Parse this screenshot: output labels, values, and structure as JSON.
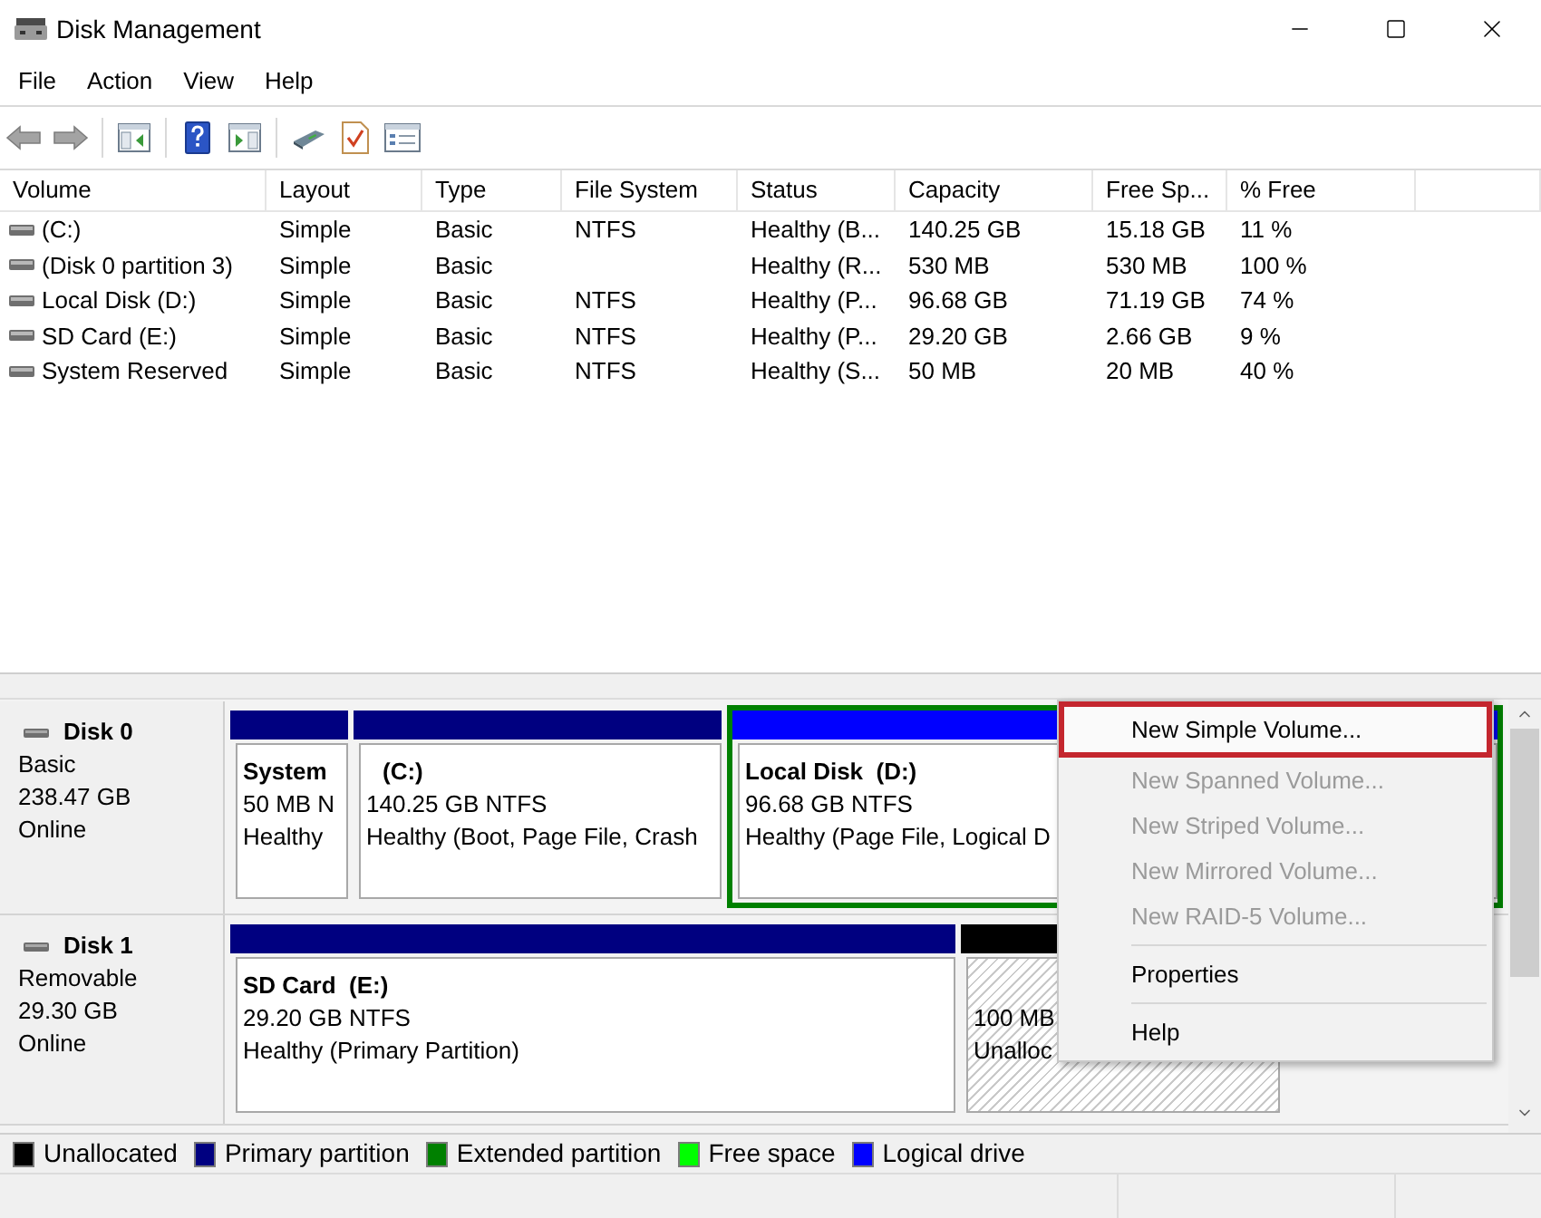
{
  "window": {
    "title": "Disk Management"
  },
  "menu_bar": [
    "File",
    "Action",
    "View",
    "Help"
  ],
  "table": {
    "columns": [
      "Volume",
      "Layout",
      "Type",
      "File System",
      "Status",
      "Capacity",
      "Free Sp...",
      "% Free"
    ],
    "rows": [
      {
        "volume": "(C:)",
        "layout": "Simple",
        "type": "Basic",
        "file_system": "NTFS",
        "status": "Healthy (B...",
        "capacity": "140.25 GB",
        "free_sp": "15.18 GB",
        "percent_free": "11 %"
      },
      {
        "volume": "(Disk 0 partition 3)",
        "layout": "Simple",
        "type": "Basic",
        "status": "Healthy (R...",
        "capacity": "530 MB",
        "free_sp": "530 MB",
        "percent_free": "100 %"
      },
      {
        "volume": "Local Disk (D:)",
        "layout": "Simple",
        "type": "Basic",
        "file_system": "NTFS",
        "status": "Healthy (P...",
        "capacity": "96.68 GB",
        "free_sp": "71.19 GB",
        "percent_free": "74 %"
      },
      {
        "volume": "SD Card (E:)",
        "layout": "Simple",
        "type": "Basic",
        "file_system": "NTFS",
        "status": "Healthy (P...",
        "capacity": "29.20 GB",
        "free_sp": "2.66 GB",
        "percent_free": "9 %"
      },
      {
        "volume": "System Reserved",
        "layout": "Simple",
        "type": "Basic",
        "file_system": "NTFS",
        "status": "Healthy (S...",
        "capacity": "50 MB",
        "free_sp": "20 MB",
        "percent_free": "40 %"
      }
    ]
  },
  "disks": [
    {
      "name": "Disk 0",
      "type": "Basic",
      "size": "238.47 GB",
      "status": "Online",
      "partitions": [
        {
          "kind": "primary",
          "name": "System",
          "size": "50 MB N",
          "status": "Healthy"
        },
        {
          "kind": "primary",
          "letter": "(C:)",
          "size": "140.25 GB NTFS",
          "status": "Healthy (Boot, Page File, Crash"
        },
        {
          "kind": "logical",
          "name": "Local Disk",
          "letter": "(D:)",
          "size": "96.68 GB NTFS",
          "status": "Healthy (Page File, Logical D"
        }
      ]
    },
    {
      "name": "Disk 1",
      "type": "Removable",
      "size": "29.30 GB",
      "status": "Online",
      "partitions": [
        {
          "kind": "primary",
          "name": "SD Card",
          "letter": "(E:)",
          "size": "29.20 GB NTFS",
          "status": "Healthy (Primary Partition)"
        },
        {
          "kind": "unallocated",
          "size": "100 MB",
          "status": "Unalloc"
        }
      ]
    }
  ],
  "context_menu": {
    "items": [
      {
        "kind": "item",
        "label": "New Simple Volume...",
        "selected": true,
        "disabled": false
      },
      {
        "kind": "item",
        "label": "New Spanned Volume...",
        "selected": false,
        "disabled": true
      },
      {
        "kind": "item",
        "label": "New Striped Volume...",
        "selected": false,
        "disabled": true
      },
      {
        "kind": "item",
        "label": "New Mirrored Volume...",
        "selected": false,
        "disabled": true
      },
      {
        "kind": "item",
        "label": "New RAID-5 Volume...",
        "selected": false,
        "disabled": true
      },
      {
        "kind": "separator"
      },
      {
        "kind": "item",
        "label": "Properties",
        "selected": false,
        "disabled": false
      },
      {
        "kind": "separator"
      },
      {
        "kind": "item",
        "label": "Help",
        "selected": false,
        "disabled": false
      }
    ]
  },
  "legend": [
    {
      "kind": "unallocated",
      "label": "Unallocated",
      "color": "#000000"
    },
    {
      "kind": "primary",
      "label": "Primary partition",
      "color": "#000080"
    },
    {
      "kind": "extended",
      "label": "Extended partition",
      "color": "#008000"
    },
    {
      "kind": "free",
      "label": "Free space",
      "color": "#00ff00"
    },
    {
      "kind": "logical",
      "label": "Logical drive",
      "color": "#0000ff"
    }
  ]
}
